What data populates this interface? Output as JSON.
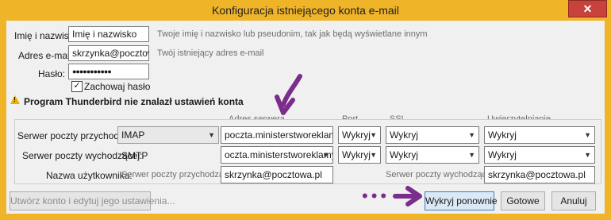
{
  "window": {
    "title": "Konfiguracja istniejącego konta e-mail"
  },
  "form": {
    "name_label": "Imię i nazwisko:",
    "name_value": "Imię i nazwisko",
    "name_hint": "Twoje imię i nazwisko lub pseudonim, tak jak będą wyświetlane innym",
    "email_label": "Adres e-mail:",
    "email_value": "skrzynka@pocztowa.pl",
    "email_hint": "Twój istniejący adres e-mail",
    "password_label": "Hasło:",
    "password_value": "●●●●●●●●●●●",
    "remember_label": "Zachowaj hasło",
    "remember_checked": true
  },
  "warning": {
    "text": "Program Thunderbird nie znalazł ustawień konta"
  },
  "servers": {
    "headers": {
      "address": "Adres serwera",
      "port": "Port",
      "ssl": "SSL",
      "auth": "Uwierzytelnianie"
    },
    "incoming": {
      "label": "Serwer poczty przychodzącej:",
      "protocol": "IMAP",
      "address": "poczta.ministerstworeklamy.pl",
      "port": "Wykryj",
      "ssl": "Wykryj",
      "auth": "Wykryj"
    },
    "outgoing": {
      "label": "Serwer poczty wychodzącej:",
      "protocol": "SMTP",
      "address": "oczta.ministerstworeklamy.pl",
      "port": "Wykryj",
      "ssl": "Wykryj",
      "auth": "Wykryj"
    },
    "username": {
      "label": "Nazwa użytkownika:",
      "in_label": "Serwer poczty przychodzącej:",
      "in_value": "skrzynka@pocztowa.pl",
      "out_label": "Serwer poczty wychodzącej:",
      "out_value": "skrzynka@pocztowa.pl"
    }
  },
  "buttons": {
    "manual": "Utwórz konto i edytuj jego ustawienia...",
    "retest": "Wykryj ponownie",
    "done": "Gotowe",
    "cancel": "Anuluj"
  },
  "icons": {
    "close": "close-icon",
    "warning": "warning-icon",
    "dropdown": "chevron-down-icon",
    "checkmark": "checkmark-icon"
  },
  "colors": {
    "window_frame": "#f0b429",
    "annotation": "#7b2d8b"
  }
}
